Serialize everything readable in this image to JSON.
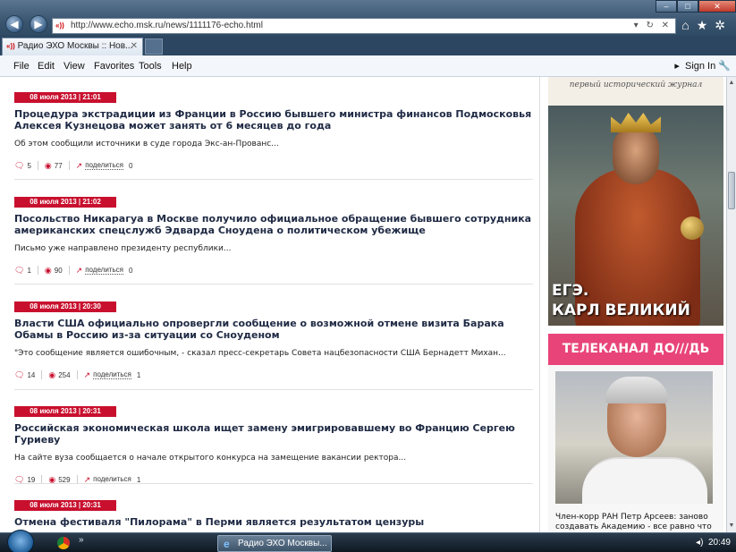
{
  "browser": {
    "url": "http://www.echo.msk.ru/news/1111176-echo.html",
    "tab_title": "Радио ЭХО Москвы :: Нов...",
    "menu": [
      "File",
      "Edit",
      "View",
      "Favorites",
      "Tools",
      "Help"
    ],
    "sign_in": "Sign In"
  },
  "news": [
    {
      "date": "08 июля 2013 | 21:01",
      "headline": "Процедура экстрадиции из Франции в Россию бывшего министра финансов Подмосковья Алексея Кузнецова может занять от 6 месяцев до года",
      "lede": "Об этом сообщили источники в суде города Экс-ан-Прованс...",
      "comments": "5",
      "views": "77",
      "share_label": "поделиться",
      "shares": "0"
    },
    {
      "date": "08 июля 2013 | 21:02",
      "headline": "Посольство Никарагуа в Москве получило официальное обращение бывшего сотрудника американских спецслужб Эдварда Сноудена о политическом убежище",
      "lede": "Письмо уже направлено президенту республики...",
      "comments": "1",
      "views": "90",
      "share_label": "поделиться",
      "shares": "0"
    },
    {
      "date": "08 июля 2013 | 20:30",
      "headline": "Власти США официально опровергли сообщение о возможной отмене визита Барака Обамы в Россию из-за ситуации со Сноуденом",
      "lede": "\"Это сообщение является ошибочным, - сказал пресс-секретарь Совета нацбезопасности США Бернадетт Михан...",
      "comments": "14",
      "views": "254",
      "share_label": "поделиться",
      "shares": "1"
    },
    {
      "date": "08 июля 2013 | 20:31",
      "headline": "Российская экономическая школа ищет замену эмигрировавшему во Францию Сергею Гуриеву",
      "lede": "На сайте вуза сообщается о начале открытого конкурса на замещение вакансии ректора...",
      "comments": "19",
      "views": "529",
      "share_label": "поделиться",
      "shares": "1"
    },
    {
      "date": "08 июля 2013 | 20:31",
      "headline": "Отмена фестиваля \"Пилорама\" в Перми является результатом цензуры"
    }
  ],
  "sidebar": {
    "journal_tagline": "первый исторический журнал",
    "banner_line1": "ЕГЭ.",
    "banner_line2": "КАРЛ ВЕЛИКИЙ",
    "channel": "ТЕЛЕКАНАЛ ДО///ДЬ",
    "caption": "Член-корр РАН Петр Арсеев: заново создавать Академию - все равно что"
  },
  "taskbar": {
    "task_label": "Радио ЭХО Москвы...",
    "clock": "20:49"
  },
  "colors": {
    "date_red": "#c8102e",
    "dozhd_pink": "#e8447a",
    "headline": "#1f2a44"
  },
  "icons": [
    "back-arrow-icon",
    "forward-arrow-icon",
    "home-icon",
    "star-icon",
    "gear-icon",
    "comment-icon",
    "eye-icon",
    "share-icon",
    "windows-start-icon",
    "chrome-icon",
    "ie-icon",
    "volume-icon"
  ]
}
